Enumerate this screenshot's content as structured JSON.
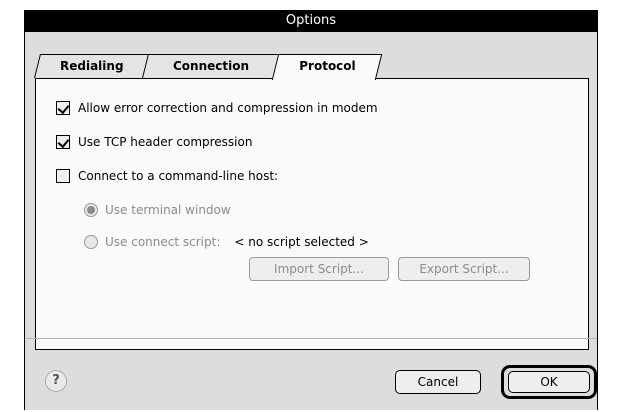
{
  "window": {
    "title": "Options"
  },
  "tabs": [
    {
      "label": "Redialing",
      "active": false
    },
    {
      "label": "Connection",
      "active": false
    },
    {
      "label": "Protocol",
      "active": true
    }
  ],
  "protocol": {
    "error_correction": {
      "label": "Allow error correction and compression in modem",
      "checked": true
    },
    "tcp_header": {
      "label": "Use TCP header compression",
      "checked": true
    },
    "command_line_host": {
      "label": "Connect to a command-line host:",
      "checked": false
    },
    "terminal_window": {
      "label": "Use terminal window",
      "selected": true,
      "enabled": false
    },
    "connect_script": {
      "label": "Use connect script:",
      "selected": false,
      "enabled": false
    },
    "script_status": "< no script selected >",
    "import_button": "Import Script...",
    "export_button": "Export Script..."
  },
  "footer": {
    "help_icon": "?",
    "cancel_label": "Cancel",
    "ok_label": "OK"
  }
}
